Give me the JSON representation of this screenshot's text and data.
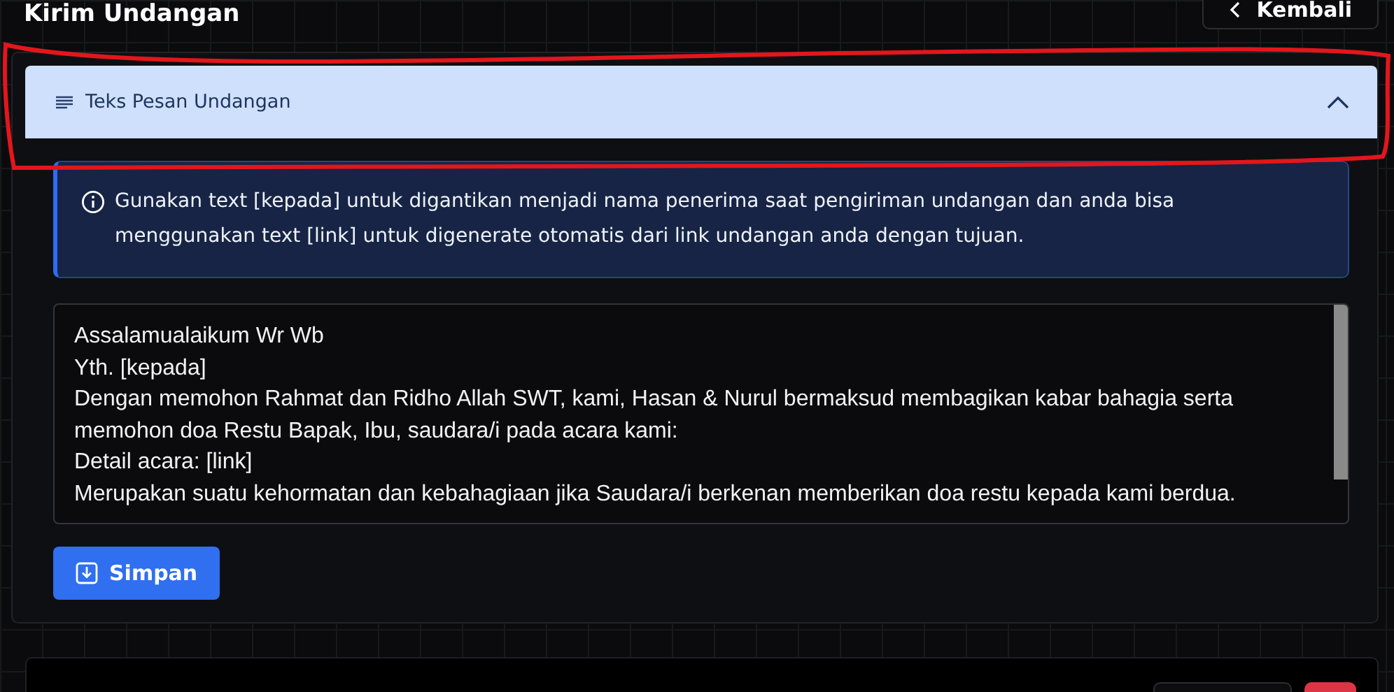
{
  "page": {
    "title": "Kirim Undangan",
    "back_button": "Kembali"
  },
  "accordion": {
    "title": "Teks Pesan Undangan",
    "expanded": true
  },
  "alert": {
    "text": "Gunakan text [kepada] untuk digantikan menjadi nama penerima saat pengiriman undangan dan anda bisa menggunakan text [link] untuk digenerate otomatis dari link undangan anda dengan tujuan."
  },
  "message": {
    "value": "Assalamualaikum Wr Wb\nYth. [kepada]\nDengan memohon Rahmat dan Ridho Allah SWT, kami, Hasan & Nurul bermaksud membagikan kabar bahagia serta memohon doa Restu Bapak, Ibu, saudara/i pada acara kami:\nDetail acara: [link]\nMerupakan suatu kehormatan dan kebahagiaan jika Saudara/i berkenan memberikan doa restu kepada kami berdua."
  },
  "save_button": "Simpan"
}
